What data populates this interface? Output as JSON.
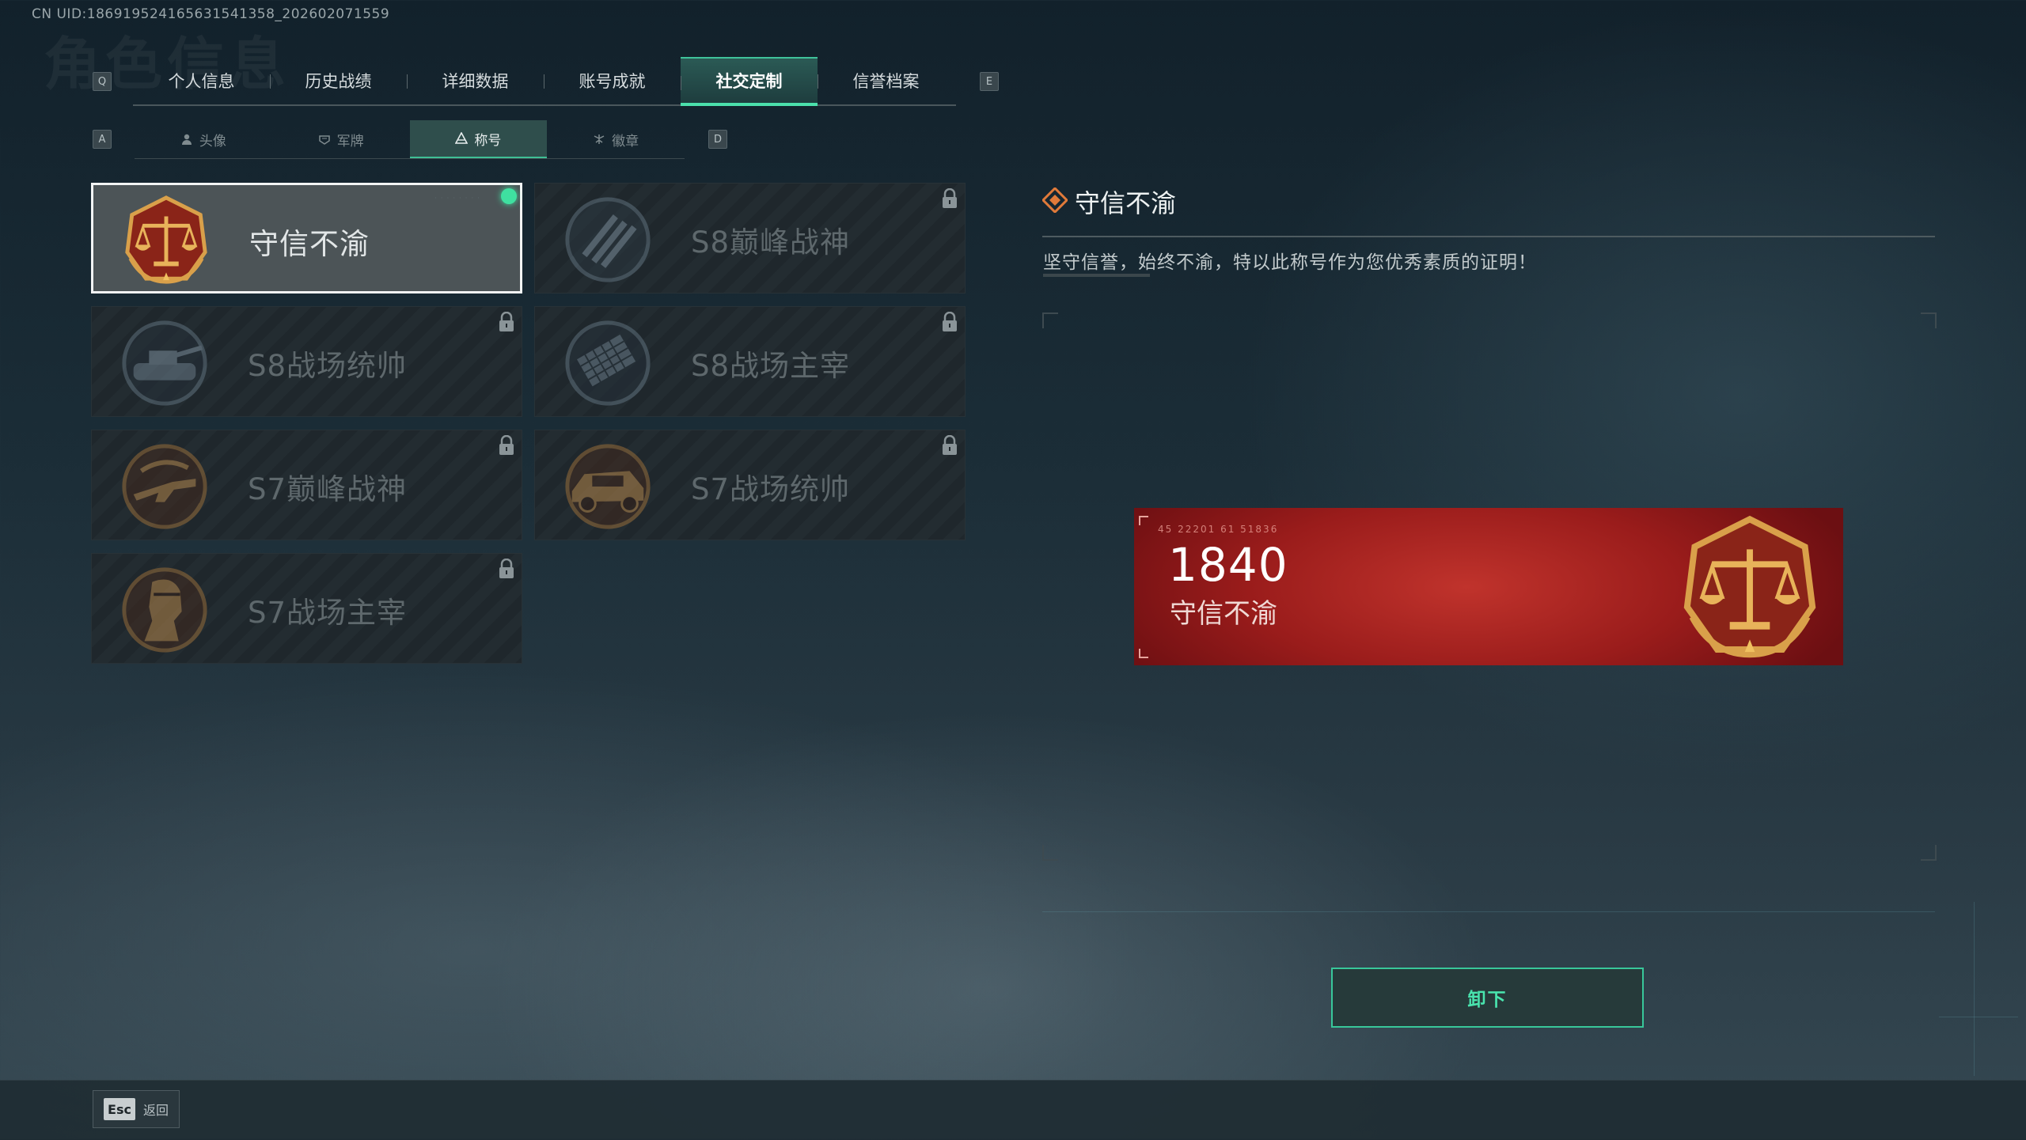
{
  "uid": "CN UID:1869195241656315413​58_202602071559",
  "ghost_title": "角色信息",
  "main_tabs": {
    "key_left": "Q",
    "key_right": "E",
    "items": [
      "个人信息",
      "历史战绩",
      "详细数据",
      "账号成就",
      "社交定制",
      "信誉档案"
    ],
    "active": "社交定制"
  },
  "sub_tabs": {
    "key_left": "A",
    "key_right": "D",
    "items": [
      {
        "label": "头像",
        "icon": "person-icon"
      },
      {
        "label": "军牌",
        "icon": "dogtag-icon"
      },
      {
        "label": "称号",
        "icon": "title-icon"
      },
      {
        "label": "徽章",
        "icon": "badge-icon"
      }
    ],
    "active": "称号"
  },
  "titles": [
    {
      "name": "守信不渝",
      "selected": true,
      "equipped": true,
      "locked": false,
      "emblem": "scales-emblem"
    },
    {
      "name": "S8巅峰战神",
      "selected": false,
      "equipped": false,
      "locked": true,
      "emblem": "stripes-emblem"
    },
    {
      "name": "S8战场统帅",
      "selected": false,
      "equipped": false,
      "locked": true,
      "emblem": "tank-emblem"
    },
    {
      "name": "S8战场主宰",
      "selected": false,
      "equipped": false,
      "locked": true,
      "emblem": "rocket-launcher-emblem"
    },
    {
      "name": "S7巅峰战神",
      "selected": false,
      "equipped": false,
      "locked": true,
      "emblem": "rifle-emblem"
    },
    {
      "name": "S7战场统帅",
      "selected": false,
      "equipped": false,
      "locked": true,
      "emblem": "vehicle-emblem"
    },
    {
      "name": "S7战场主宰",
      "selected": false,
      "equipped": false,
      "locked": true,
      "emblem": "soldier-emblem"
    }
  ],
  "detail": {
    "title": "守信不渝",
    "description": "坚守信誉，始终不渝，特以此称号作为您优秀素质的证明！"
  },
  "banner": {
    "number": "1840",
    "title": "守信不渝",
    "code": "45 22201  61 51836"
  },
  "unequip_label": "卸下",
  "footer": {
    "esc_key": "Esc",
    "esc_label": "返回"
  },
  "colors": {
    "accent": "#49e4ae",
    "banner_red": "#a3201f",
    "emblem_gold": "#d9a04a",
    "emblem_red": "#8a2418"
  }
}
